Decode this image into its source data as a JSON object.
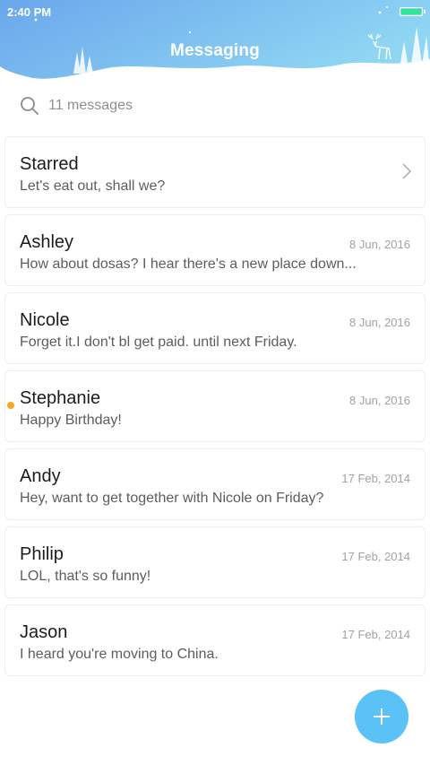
{
  "status_bar": {
    "time": "2:40 PM",
    "battery_level": 1.0
  },
  "header": {
    "title": "Messaging",
    "colors": {
      "gradient_start": "#6aa6ec",
      "gradient_end": "#8fd6f3"
    }
  },
  "search": {
    "label": "11 messages",
    "icon": "search-icon"
  },
  "conversations": [
    {
      "name": "Starred",
      "preview": "Let's eat out, shall we?",
      "date": "",
      "unread": false,
      "chevron": true
    },
    {
      "name": "Ashley",
      "preview": "How about dosas? I hear there's a new place down...",
      "date": "8 Jun, 2016",
      "unread": false
    },
    {
      "name": "Nicole",
      "preview": "Forget it.I don't bl get paid. until next Friday.",
      "date": "8 Jun, 2016",
      "unread": false
    },
    {
      "name": "Stephanie",
      "preview": "Happy Birthday!",
      "date": "8 Jun, 2016",
      "unread": true
    },
    {
      "name": "Andy",
      "preview": "Hey, want to get together with Nicole on Friday?",
      "date": "17 Feb, 2014",
      "unread": false
    },
    {
      "name": "Philip",
      "preview": "LOL, that's so funny!",
      "date": "17 Feb, 2014",
      "unread": false
    },
    {
      "name": "Jason",
      "preview": "I heard you're moving to China.",
      "date": "17 Feb, 2014",
      "unread": false
    }
  ],
  "colors": {
    "unread_dot": "#f5a623",
    "fab": "#5bc2f7",
    "battery": "#2fe59a"
  },
  "fab": {
    "icon": "plus-icon"
  }
}
